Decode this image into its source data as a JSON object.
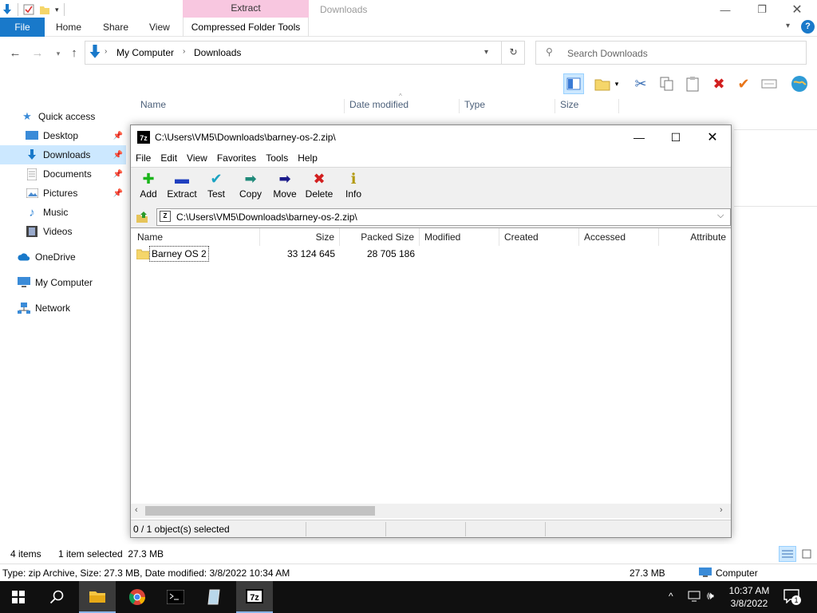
{
  "titlebar": {
    "context_tab": "Extract",
    "window_title": "Downloads"
  },
  "ribbon": {
    "file": "File",
    "tabs": [
      "Home",
      "Share",
      "View"
    ],
    "context_tab": "Compressed Folder Tools"
  },
  "address": {
    "root": "My Computer",
    "current": "Downloads",
    "search_placeholder": "Search Downloads"
  },
  "nav": {
    "items": [
      {
        "label": "Quick access",
        "icon": "star-icon"
      },
      {
        "label": "Desktop",
        "icon": "desktop-icon"
      },
      {
        "label": "Downloads",
        "icon": "download-arrow-icon"
      },
      {
        "label": "Documents",
        "icon": "documents-icon"
      },
      {
        "label": "Pictures",
        "icon": "pictures-icon"
      },
      {
        "label": "Music",
        "icon": "music-icon"
      },
      {
        "label": "Videos",
        "icon": "videos-icon"
      },
      {
        "label": "OneDrive",
        "icon": "cloud-icon"
      },
      {
        "label": "My Computer",
        "icon": "computer-icon"
      },
      {
        "label": "Network",
        "icon": "network-icon"
      }
    ]
  },
  "columns": [
    "Name",
    "Date modified",
    "Type",
    "Size"
  ],
  "zip_window": {
    "title": "C:\\Users\\VM5\\Downloads\\barney-os-2.zip\\",
    "menu": [
      "File",
      "Edit",
      "View",
      "Favorites",
      "Tools",
      "Help"
    ],
    "tools": [
      {
        "label": "Add",
        "glyph": "✚",
        "color": "#1bb51b"
      },
      {
        "label": "Extract",
        "glyph": "▬",
        "color": "#1f3fbf"
      },
      {
        "label": "Test",
        "glyph": "✔",
        "color": "#1aa3c2"
      },
      {
        "label": "Copy",
        "glyph": "➡",
        "color": "#208a7a"
      },
      {
        "label": "Move",
        "glyph": "➡",
        "color": "#1a1a8a"
      },
      {
        "label": "Delete",
        "glyph": "✖",
        "color": "#d21f1f"
      },
      {
        "label": "Info",
        "glyph": "ℹ",
        "color": "#b39a10"
      }
    ],
    "path": "C:\\Users\\VM5\\Downloads\\barney-os-2.zip\\",
    "list_headers": [
      "Name",
      "Size",
      "Packed Size",
      "Modified",
      "Created",
      "Accessed",
      "Attribute"
    ],
    "rows": [
      {
        "name": "Barney OS 2",
        "size": "33 124 645",
        "packed": "28 705 186"
      }
    ],
    "status": "0 / 1 object(s) selected"
  },
  "explorer_status": {
    "items": "4 items",
    "selected": "1 item selected  27.3 MB"
  },
  "info_bar": {
    "details": "Type: zip Archive, Size: 27.3 MB, Date modified: 3/8/2022 10:34 AM",
    "size": "27.3 MB",
    "location": "Computer"
  },
  "taskbar": {
    "time": "10:37 AM",
    "date": "3/8/2022",
    "notifications": "1"
  }
}
